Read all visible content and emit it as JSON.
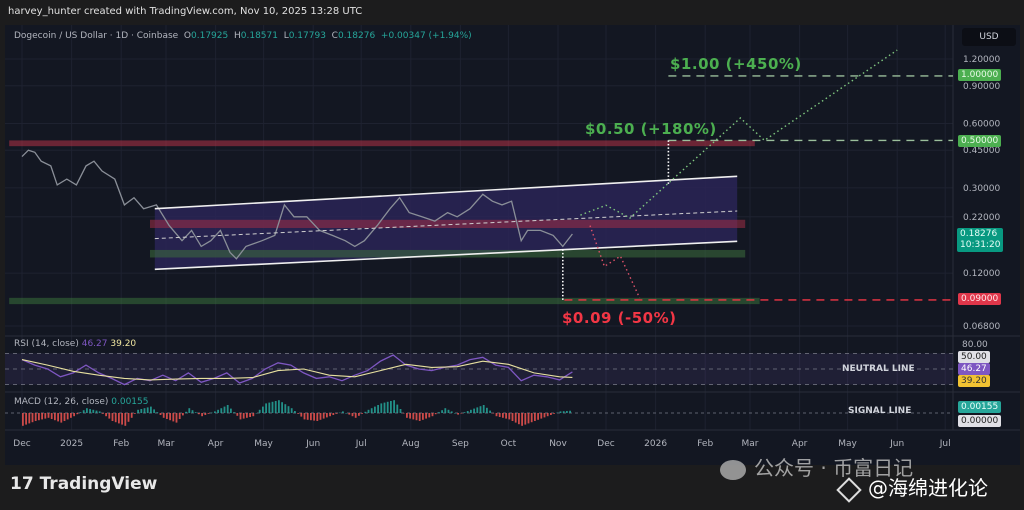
{
  "header": {
    "credit": "harvey_hunter created with TradingView.com, Nov 10, 2025 13:28 UTC"
  },
  "legend": {
    "symbol": "Dogecoin / US Dollar · 1D · Coinbase",
    "o_label": "O",
    "o": "0.17925",
    "h_label": "H",
    "h": "0.18571",
    "l_label": "L",
    "l": "0.17793",
    "c_label": "C",
    "c": "0.18276",
    "change": "+0.00347 (+1.94%)"
  },
  "currency_button": "USD",
  "targets": {
    "t1": "$1.00 (+450%)",
    "t2": "$0.50 (+180%)",
    "t3": "$0.09 (-50%)"
  },
  "price_tags": {
    "t1": "1.00000",
    "t2": "0.50000",
    "current": "0.18276",
    "countdown": "10:31:20",
    "t3": "0.09000"
  },
  "rsi": {
    "title": "RSI (14, close)",
    "value": "46.27",
    "ma_value": "39.20",
    "top_tick": "80.00",
    "neutral_tag": "50.00",
    "neutral_label": "NEUTRAL LINE"
  },
  "macd": {
    "title": "MACD (12, 26, close)",
    "value": "0.00155",
    "zero_tag": "0.00000",
    "signal_label": "SIGNAL LINE"
  },
  "footer": {
    "logo_text": "TradingView"
  },
  "watermark": {
    "line1": "公众号 · 币富日记",
    "line2": "@海绵进化论"
  },
  "colors": {
    "up": "#26a69a",
    "down": "#ef5350",
    "green_target": "#4caf50",
    "red_target": "#f23645",
    "rsi": "#7e57c2",
    "rsi_ma": "#e8e1a0",
    "channel": "#2a2556"
  },
  "chart_data": {
    "type": "line",
    "title": "Dogecoin / US Dollar · 1D · Coinbase",
    "x_unit": "days since 2024-12-01",
    "y_scale": "log",
    "ylim": [
      0.068,
      1.2
    ],
    "y_ticks": [
      "1.20000",
      "0.90000",
      "0.60000",
      "0.45000",
      "0.30000",
      "0.22000",
      "0.12000",
      "0.06800"
    ],
    "y_tick_values": [
      1.2,
      0.9,
      0.6,
      0.45,
      0.3,
      0.22,
      0.12,
      0.068
    ],
    "x_ticks": [
      {
        "label": "Dec",
        "day": 0
      },
      {
        "label": "2025",
        "day": 31
      },
      {
        "label": "Feb",
        "day": 62
      },
      {
        "label": "Mar",
        "day": 90
      },
      {
        "label": "Apr",
        "day": 121
      },
      {
        "label": "May",
        "day": 151
      },
      {
        "label": "Jun",
        "day": 182
      },
      {
        "label": "Jul",
        "day": 212
      },
      {
        "label": "Aug",
        "day": 243
      },
      {
        "label": "Sep",
        "day": 274
      },
      {
        "label": "Oct",
        "day": 304
      },
      {
        "label": "Nov",
        "day": 335
      },
      {
        "label": "Dec",
        "day": 365
      },
      {
        "label": "2026",
        "day": 396
      },
      {
        "label": "Feb",
        "day": 427
      },
      {
        "label": "Mar",
        "day": 455
      },
      {
        "label": "Apr",
        "day": 486
      },
      {
        "label": "May",
        "day": 516
      },
      {
        "label": "Jun",
        "day": 547
      },
      {
        "label": "Jul",
        "day": 577
      }
    ],
    "price": [
      [
        0,
        0.42
      ],
      [
        4,
        0.45
      ],
      [
        8,
        0.44
      ],
      [
        12,
        0.4
      ],
      [
        18,
        0.38
      ],
      [
        22,
        0.31
      ],
      [
        28,
        0.33
      ],
      [
        34,
        0.31
      ],
      [
        40,
        0.38
      ],
      [
        45,
        0.4
      ],
      [
        50,
        0.36
      ],
      [
        58,
        0.33
      ],
      [
        64,
        0.25
      ],
      [
        70,
        0.27
      ],
      [
        76,
        0.24
      ],
      [
        84,
        0.25
      ],
      [
        92,
        0.2
      ],
      [
        100,
        0.17
      ],
      [
        106,
        0.19
      ],
      [
        112,
        0.16
      ],
      [
        118,
        0.17
      ],
      [
        124,
        0.19
      ],
      [
        130,
        0.15
      ],
      [
        134,
        0.14
      ],
      [
        140,
        0.16
      ],
      [
        150,
        0.17
      ],
      [
        158,
        0.18
      ],
      [
        164,
        0.25
      ],
      [
        170,
        0.22
      ],
      [
        178,
        0.22
      ],
      [
        186,
        0.19
      ],
      [
        194,
        0.18
      ],
      [
        202,
        0.17
      ],
      [
        208,
        0.16
      ],
      [
        214,
        0.17
      ],
      [
        222,
        0.2
      ],
      [
        230,
        0.24
      ],
      [
        236,
        0.27
      ],
      [
        242,
        0.23
      ],
      [
        250,
        0.22
      ],
      [
        258,
        0.21
      ],
      [
        266,
        0.23
      ],
      [
        272,
        0.22
      ],
      [
        280,
        0.24
      ],
      [
        288,
        0.28
      ],
      [
        294,
        0.26
      ],
      [
        300,
        0.25
      ],
      [
        306,
        0.26
      ],
      [
        312,
        0.17
      ],
      [
        316,
        0.19
      ],
      [
        324,
        0.19
      ],
      [
        332,
        0.18
      ],
      [
        338,
        0.16
      ],
      [
        344,
        0.18276
      ]
    ],
    "annotations": {
      "channel_upper": [
        [
          83,
          0.24
        ],
        [
          447,
          0.34
        ]
      ],
      "channel_lower": [
        [
          83,
          0.125
        ],
        [
          447,
          0.169
        ]
      ],
      "channel_mid": [
        [
          83,
          0.174
        ],
        [
          447,
          0.234
        ]
      ],
      "red_zone_mid": {
        "from": 80,
        "to": 452,
        "low": 0.195,
        "high": 0.213
      },
      "green_zone_mid": {
        "from": 80,
        "to": 452,
        "low": 0.142,
        "high": 0.154
      },
      "red_zone_top": {
        "from": -8,
        "to": 458,
        "low": 0.47,
        "high": 0.5
      },
      "green_zone_bottom": {
        "from": -8,
        "to": 461,
        "low": 0.086,
        "high": 0.092
      },
      "target_lines": [
        {
          "price": 1.0,
          "from": 404,
          "color": "#9bbf9b"
        },
        {
          "price": 0.5,
          "from": 404,
          "color": "#9bbf9b"
        },
        {
          "price": 0.09,
          "from": 339,
          "color": "#f23645"
        }
      ],
      "measure_lines": [
        {
          "day": 404,
          "from": 0.5,
          "to": 0.31
        },
        {
          "day": 338,
          "from": 0.155,
          "to": 0.09
        }
      ],
      "bull_path": [
        [
          349,
          0.224
        ],
        [
          365,
          0.249
        ],
        [
          380,
          0.217
        ],
        [
          449,
          0.636
        ],
        [
          464,
          0.5
        ],
        [
          547,
          1.32
        ]
      ],
      "bear_path": [
        [
          355,
          0.2
        ],
        [
          364,
          0.129
        ],
        [
          374,
          0.144
        ],
        [
          386,
          0.092
        ]
      ]
    },
    "rsi_series": [
      [
        0,
        62
      ],
      [
        8,
        55
      ],
      [
        16,
        50
      ],
      [
        24,
        40
      ],
      [
        32,
        45
      ],
      [
        40,
        55
      ],
      [
        48,
        45
      ],
      [
        56,
        38
      ],
      [
        64,
        30
      ],
      [
        72,
        38
      ],
      [
        80,
        35
      ],
      [
        88,
        42
      ],
      [
        96,
        35
      ],
      [
        104,
        45
      ],
      [
        112,
        33
      ],
      [
        120,
        38
      ],
      [
        128,
        45
      ],
      [
        136,
        32
      ],
      [
        144,
        38
      ],
      [
        152,
        50
      ],
      [
        160,
        58
      ],
      [
        168,
        55
      ],
      [
        176,
        45
      ],
      [
        184,
        38
      ],
      [
        192,
        40
      ],
      [
        200,
        35
      ],
      [
        208,
        42
      ],
      [
        216,
        48
      ],
      [
        224,
        60
      ],
      [
        232,
        68
      ],
      [
        240,
        55
      ],
      [
        248,
        50
      ],
      [
        256,
        48
      ],
      [
        264,
        52
      ],
      [
        272,
        55
      ],
      [
        280,
        62
      ],
      [
        288,
        65
      ],
      [
        296,
        55
      ],
      [
        304,
        52
      ],
      [
        312,
        35
      ],
      [
        320,
        42
      ],
      [
        328,
        40
      ],
      [
        336,
        36
      ],
      [
        344,
        46.27
      ]
    ],
    "rsi_ma_series": [
      [
        0,
        62
      ],
      [
        16,
        55
      ],
      [
        32,
        47
      ],
      [
        48,
        42
      ],
      [
        64,
        38
      ],
      [
        80,
        36
      ],
      [
        96,
        37
      ],
      [
        112,
        38
      ],
      [
        128,
        38
      ],
      [
        144,
        39
      ],
      [
        160,
        48
      ],
      [
        176,
        50
      ],
      [
        192,
        42
      ],
      [
        208,
        40
      ],
      [
        224,
        48
      ],
      [
        240,
        56
      ],
      [
        256,
        52
      ],
      [
        272,
        53
      ],
      [
        288,
        60
      ],
      [
        304,
        56
      ],
      [
        320,
        45
      ],
      [
        336,
        40
      ],
      [
        344,
        39.2
      ]
    ],
    "macd_histogram": [
      [
        0,
        -8
      ],
      [
        8,
        -5
      ],
      [
        16,
        -3
      ],
      [
        24,
        -6
      ],
      [
        32,
        -2
      ],
      [
        40,
        3
      ],
      [
        48,
        1
      ],
      [
        56,
        -5
      ],
      [
        64,
        -8
      ],
      [
        72,
        2
      ],
      [
        80,
        4
      ],
      [
        88,
        -3
      ],
      [
        96,
        -6
      ],
      [
        104,
        3
      ],
      [
        112,
        -2
      ],
      [
        120,
        1
      ],
      [
        128,
        5
      ],
      [
        136,
        -4
      ],
      [
        144,
        -2
      ],
      [
        152,
        6
      ],
      [
        160,
        8
      ],
      [
        168,
        3
      ],
      [
        176,
        -4
      ],
      [
        184,
        -5
      ],
      [
        192,
        -2
      ],
      [
        200,
        1
      ],
      [
        208,
        -3
      ],
      [
        216,
        2
      ],
      [
        224,
        6
      ],
      [
        232,
        8
      ],
      [
        240,
        -3
      ],
      [
        248,
        -5
      ],
      [
        256,
        -2
      ],
      [
        264,
        3
      ],
      [
        272,
        -1
      ],
      [
        280,
        2
      ],
      [
        288,
        5
      ],
      [
        296,
        -2
      ],
      [
        304,
        -4
      ],
      [
        312,
        -8
      ],
      [
        320,
        -5
      ],
      [
        328,
        -2
      ],
      [
        336,
        1
      ],
      [
        344,
        1.55
      ]
    ],
    "macd_unit": 0.001
  }
}
